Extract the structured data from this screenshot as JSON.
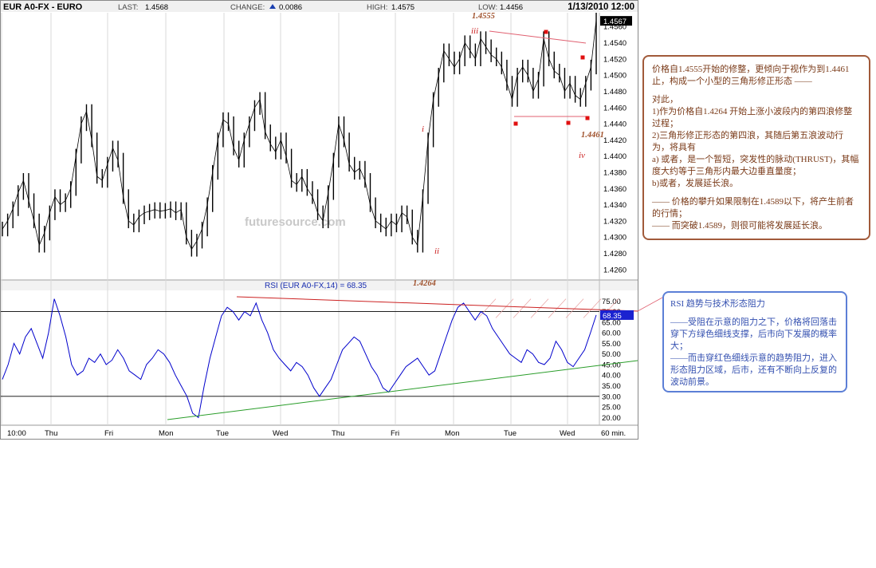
{
  "header": {
    "symbol": "EUR A0-FX - EURO",
    "last_label": "LAST:",
    "last_value": "1.4568",
    "change_label": "CHANGE:",
    "change_value": "0.0086",
    "high_label": "HIGH:",
    "high_value": "1.4575",
    "low_label": "LOW:",
    "low_value": "1.4456",
    "datetime": "1/13/2010 12:00"
  },
  "watermark": "futuresource.com",
  "chart_data": [
    {
      "type": "line",
      "panel": "price",
      "series": [
        {
          "values": [
            1.431,
            1.432,
            1.4335,
            1.4355,
            1.437,
            1.4345,
            1.432,
            1.429,
            1.4305,
            1.433,
            1.435,
            1.434,
            1.4345,
            1.436,
            1.44,
            1.444,
            1.4455,
            1.442,
            1.4375,
            1.437,
            1.439,
            1.441,
            1.4395,
            1.435,
            1.432,
            1.4315,
            1.4325,
            1.433,
            1.4332,
            1.4334,
            1.4332,
            1.4333,
            1.4335,
            1.433,
            1.4334,
            1.43,
            1.4285,
            1.4295,
            1.431,
            1.434,
            1.438,
            1.442,
            1.4445,
            1.444,
            1.441,
            1.4395,
            1.442,
            1.444,
            1.446,
            1.447,
            1.443,
            1.4415,
            1.4405,
            1.442,
            1.44,
            1.437,
            1.4365,
            1.4375,
            1.436,
            1.435,
            1.433,
            1.432,
            1.4355,
            1.4395,
            1.444,
            1.442,
            1.439,
            1.438,
            1.4385,
            1.437,
            1.434,
            1.432,
            1.4315,
            1.431,
            1.432,
            1.4315,
            1.433,
            1.4325,
            1.43,
            1.429,
            1.435,
            1.442,
            1.447,
            1.45,
            1.453,
            1.452,
            1.451,
            1.452,
            1.454,
            1.453,
            1.452,
            1.4545,
            1.4535,
            1.4525,
            1.452,
            1.451,
            1.449,
            1.447,
            1.45,
            1.451,
            1.45,
            1.448,
            1.4495,
            1.4545,
            1.452,
            1.4505,
            1.45,
            1.448,
            1.449,
            1.4475,
            1.447,
            1.449,
            1.451,
            1.4568
          ]
        }
      ],
      "ohlc_note": "close approximations read from candlestick bars",
      "ylim": [
        1.425,
        1.4575
      ],
      "y_ticks": [
        "1.4560",
        "1.4540",
        "1.4520",
        "1.4500",
        "1.4480",
        "1.4460",
        "1.4440",
        "1.4420",
        "1.4400",
        "1.4380",
        "1.4360",
        "1.4340",
        "1.4320",
        "1.4300",
        "1.4280",
        "1.4260"
      ],
      "last_price_label": "1.4567",
      "annotations": {
        "top_price": "1.4555",
        "bottom_price": "1.4264",
        "triangle_low": "1.4461",
        "wave_iii": "iii",
        "wave_i": "i",
        "wave_ii": "ii",
        "wave_iv": "iv"
      }
    },
    {
      "type": "line",
      "panel": "rsi",
      "title": "RSI (EUR A0-FX,14) = 68.35",
      "series": [
        {
          "values": [
            38,
            45,
            55,
            50,
            58,
            62,
            55,
            48,
            60,
            76,
            68,
            58,
            45,
            40,
            42,
            48,
            46,
            50,
            45,
            47,
            52,
            48,
            42,
            40,
            38,
            45,
            48,
            52,
            50,
            46,
            40,
            35,
            30,
            22,
            20,
            35,
            48,
            58,
            68,
            72,
            70,
            66,
            70,
            68,
            74,
            66,
            60,
            52,
            48,
            45,
            42,
            46,
            44,
            40,
            34,
            30,
            34,
            38,
            45,
            52,
            55,
            58,
            56,
            50,
            44,
            40,
            34,
            32,
            36,
            40,
            44,
            46,
            48,
            44,
            40,
            42,
            50,
            58,
            66,
            72,
            74,
            70,
            66,
            70,
            68,
            62,
            58,
            54,
            50,
            48,
            46,
            52,
            50,
            46,
            45,
            48,
            56,
            52,
            46,
            44,
            48,
            52,
            60,
            68.35
          ]
        }
      ],
      "ylim": [
        17.5,
        80
      ],
      "y_ticks": [
        "75.00",
        "70.00",
        "65.00",
        "60.00",
        "55.00",
        "50.00",
        "45.00",
        "40.00",
        "35.00",
        "30.00",
        "25.00",
        "20.00"
      ],
      "last_value_label": "68.35"
    }
  ],
  "x_axis_labels": [
    "10:00",
    "Thu",
    "Fri",
    "Mon",
    "Tue",
    "Wed",
    "Thu",
    "Fri",
    "Mon",
    "Tue",
    "Wed",
    "60 min."
  ],
  "notes": {
    "brown": [
      "价格自1.4555开始的修整，更倾向于视作为到1.4461止，构成一个小型的三角形修正形态 ——",
      "",
      "对此，",
      "1)作为价格自1.4264 开始上涨小波段内的第四浪修整过程；",
      "2)三角形修正形态的第四浪，其随后第五浪波动行为，将具有",
      "a) 或者，是一个暂短，突发性的脉动(THRUST)，其幅度大约等于三角形内最大边垂直量度；",
      "b)或者，发展延长浪。",
      "",
      "—— 价格的攀升如果限制在1.4589以下，将产生前者的行情；",
      "—— 而突破1.4589，则很可能将发展延长浪。"
    ],
    "blue": [
      "RSI 趋势与技术形态阻力",
      "",
      "——受阻在示意的阻力之下，价格将回落击穿下方绿色细线支撑，后市向下发展的概率大；",
      "——而击穿红色细线示意的趋势阻力，进入形态阻力区域，后市，还有不断向上反复的波动前景。"
    ]
  },
  "colors": {
    "price": "#000000",
    "rsi": "#0000cc",
    "support": "#2a9d2a",
    "resistance": "#cc2222",
    "brown_text": "#7a3a18",
    "blue_text": "#3450b0",
    "marker": "#e01010"
  }
}
